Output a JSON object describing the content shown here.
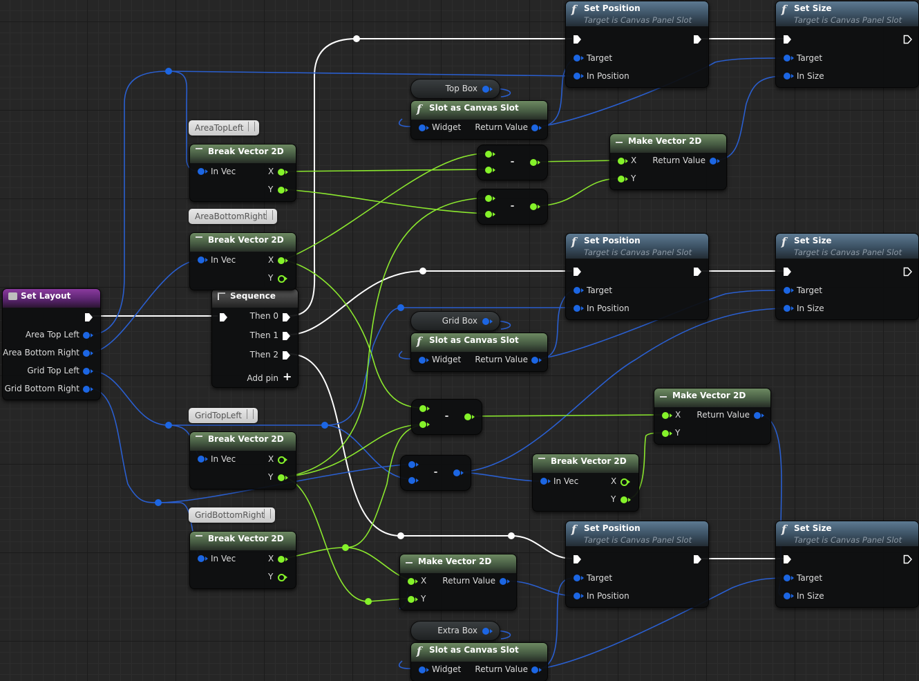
{
  "colors": {
    "exec": "#ffffff",
    "vector": "#85f22a",
    "object": "#1c66e3",
    "grid_bg": "#262626"
  },
  "set_layout": {
    "title": "Set Layout",
    "pins": [
      "Area Top Left",
      "Area Bottom Right",
      "Grid Top Left",
      "Grid Bottom Right"
    ]
  },
  "sequence": {
    "title": "Sequence",
    "pins": [
      "Then 0",
      "Then 1",
      "Then 2"
    ],
    "add_pin": "Add pin"
  },
  "comments": {
    "area_top_left": "AreaTopLeft",
    "area_bottom_right": "AreaBottomRight",
    "grid_top_left": "GridTopLeft",
    "grid_bottom_right": "GridBottomRight"
  },
  "break_vector": {
    "title": "Break Vector 2D",
    "in": "In Vec",
    "x": "X",
    "y": "Y"
  },
  "make_vector": {
    "title": "Make Vector 2D",
    "x": "X",
    "y": "Y",
    "out": "Return Value"
  },
  "set_position": {
    "title": "Set Position",
    "subtitle": "Target is Canvas Panel Slot",
    "target": "Target",
    "in": "In Position"
  },
  "set_size": {
    "title": "Set Size",
    "subtitle": "Target is Canvas Panel Slot",
    "target": "Target",
    "in": "In Size"
  },
  "slot_as_canvas": {
    "title": "Slot as Canvas Slot",
    "in": "Widget",
    "out": "Return Value"
  },
  "vars": {
    "top_box": "Top Box",
    "grid_box": "Grid Box",
    "extra_box": "Extra Box"
  },
  "subtract_op": "-"
}
